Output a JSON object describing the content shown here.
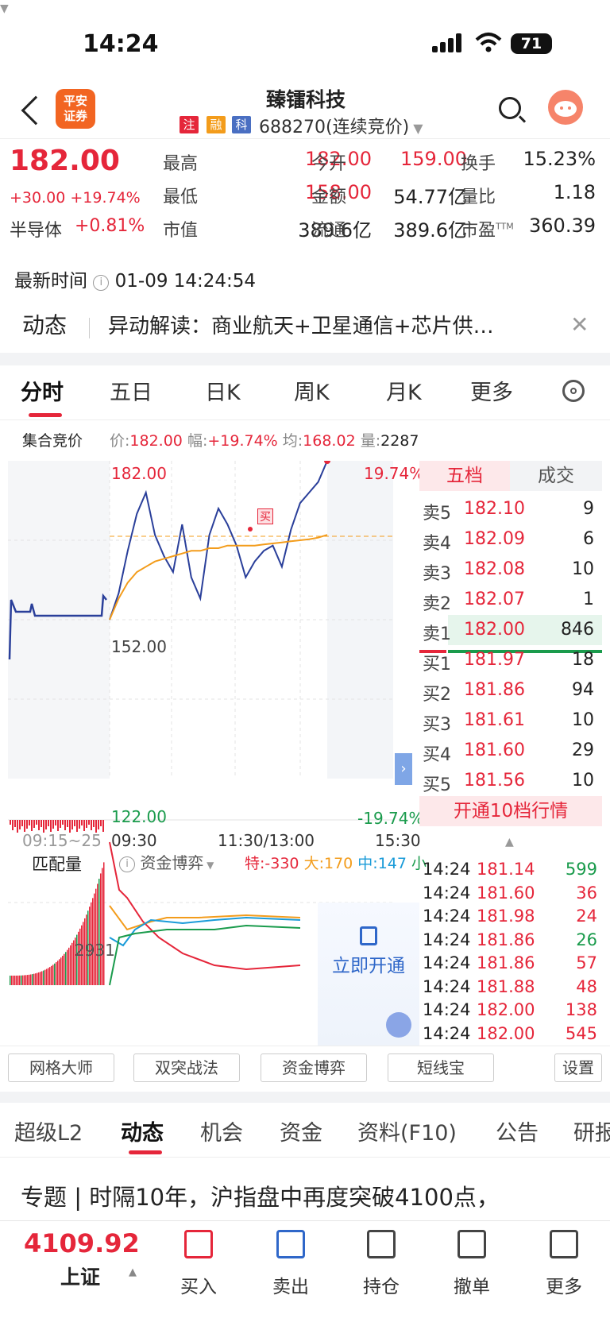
{
  "status": {
    "time": "14:24",
    "battery": "71"
  },
  "header": {
    "logo": "平安证券",
    "logo_line1": "平安",
    "logo_line2": "证券",
    "stock_name": "臻镭科技",
    "tags": [
      "注",
      "融",
      "科"
    ],
    "code": "688270(连续竞价)"
  },
  "quote": {
    "price": "182.00",
    "change": "+30.00 +19.74%",
    "sector": "半导体",
    "sector_pct": "+0.81%",
    "fields": [
      {
        "label": "最高",
        "value": "182.00",
        "color": "red"
      },
      {
        "label": "今开",
        "value": "159.00",
        "color": "red"
      },
      {
        "label": "换手",
        "value": "15.23%",
        "color": "black"
      },
      {
        "label": "最低",
        "value": "158.00",
        "color": "red"
      },
      {
        "label": "金额",
        "value": "54.77亿",
        "color": "black"
      },
      {
        "label": "量比",
        "value": "1.18",
        "color": "black"
      },
      {
        "label": "市值",
        "value": "389.6亿",
        "color": "black"
      },
      {
        "label": "流通",
        "value": "389.6亿",
        "color": "black"
      },
      {
        "label": "市盈TTM",
        "value": "360.39",
        "color": "black"
      }
    ],
    "update_label": "最新时间",
    "update_time": "01-09 14:24:54"
  },
  "dynamic": {
    "label": "动态",
    "text": "异动解读：商业航天+卫星通信+芯片供…"
  },
  "chart_tabs": [
    "分时",
    "五日",
    "日K",
    "周K",
    "月K",
    "更多"
  ],
  "auction": {
    "label": "集合竞价",
    "price_label": "价:",
    "price": "182.00",
    "amp_label": "幅:",
    "amp": "+19.74%",
    "avg_label": "均:",
    "avg": "168.02",
    "vol_label": "量:",
    "vol": "2287"
  },
  "chart_data": {
    "type": "line",
    "title": "",
    "xlabel": "",
    "ylabel": "",
    "x_ticks": [
      "09:15~25",
      "09:30",
      "11:30/13:00",
      "15:30"
    ],
    "y_ticks": [
      "182.00",
      "152.00",
      "122.00"
    ],
    "right_ticks": [
      "19.74%",
      "-19.74%"
    ],
    "ylim": [
      122.0,
      182.0
    ],
    "series": [
      {
        "values": [
          152,
          157,
          165,
          172,
          176,
          168,
          164,
          161,
          170,
          160,
          156,
          168,
          173,
          170,
          166,
          160,
          163,
          165,
          166,
          162,
          169,
          174,
          176,
          178,
          182
        ]
      },
      {
        "values": [
          152,
          156,
          159,
          161,
          162,
          163,
          163.5,
          164,
          164.5,
          165,
          165,
          165.5,
          165.5,
          166,
          166,
          166,
          166,
          166.2,
          166.4,
          166.6,
          166.8,
          167,
          167.2,
          167.5,
          168.02
        ]
      }
    ],
    "marker_label": "买"
  },
  "orderbook": {
    "tabs": [
      "五档",
      "成交"
    ],
    "sells": [
      {
        "label": "卖5",
        "price": "182.10",
        "vol": "9"
      },
      {
        "label": "卖4",
        "price": "182.09",
        "vol": "6"
      },
      {
        "label": "卖3",
        "price": "182.08",
        "vol": "10"
      },
      {
        "label": "卖2",
        "price": "182.07",
        "vol": "1"
      },
      {
        "label": "卖1",
        "price": "182.00",
        "vol": "846"
      }
    ],
    "buys": [
      {
        "label": "买1",
        "price": "181.97",
        "vol": "18"
      },
      {
        "label": "买2",
        "price": "181.86",
        "vol": "94"
      },
      {
        "label": "买3",
        "price": "181.61",
        "vol": "10"
      },
      {
        "label": "买4",
        "price": "181.60",
        "vol": "29"
      },
      {
        "label": "买5",
        "price": "181.56",
        "vol": "10"
      }
    ],
    "open10": "开通10档行情"
  },
  "ticks": [
    {
      "time": "14:24",
      "price": "181.14",
      "vol": "599",
      "color": "green"
    },
    {
      "time": "14:24",
      "price": "181.60",
      "vol": "36",
      "color": "red"
    },
    {
      "time": "14:24",
      "price": "181.98",
      "vol": "24",
      "color": "red"
    },
    {
      "time": "14:24",
      "price": "181.86",
      "vol": "26",
      "color": "green"
    },
    {
      "time": "14:24",
      "price": "181.86",
      "vol": "57",
      "color": "red"
    },
    {
      "time": "14:24",
      "price": "181.88",
      "vol": "48",
      "color": "red"
    },
    {
      "time": "14:24",
      "price": "182.00",
      "vol": "138",
      "color": "red"
    },
    {
      "time": "14:24",
      "price": "182.00",
      "vol": "545",
      "color": "red"
    }
  ],
  "lower": {
    "left_label": "匹配量",
    "indicator": "资金博弈",
    "te": "特:-330",
    "da": "大:170",
    "zhong": "中:147",
    "xiao": "小",
    "level": "2931",
    "unlock": "立即开通"
  },
  "tools": [
    "网格大师",
    "双突战法",
    "资金博弈",
    "短线宝",
    "设置"
  ],
  "bottom_tabs": [
    "超级L2",
    "动态",
    "机会",
    "资金",
    "资料(F10)",
    "公告",
    "研报"
  ],
  "news": "专题 | 时隔10年，沪指盘中再度突破4100点，",
  "bottom_bar": {
    "index_value": "4109.92",
    "index_name": "上证",
    "buttons": [
      "买入",
      "卖出",
      "持仓",
      "撤单",
      "更多"
    ]
  },
  "colors": {
    "up": "#e5263a",
    "down": "#1a9b4c",
    "price_line": "#2a3f9a",
    "avg_line": "#f39c1b",
    "brand": "#f26522"
  }
}
